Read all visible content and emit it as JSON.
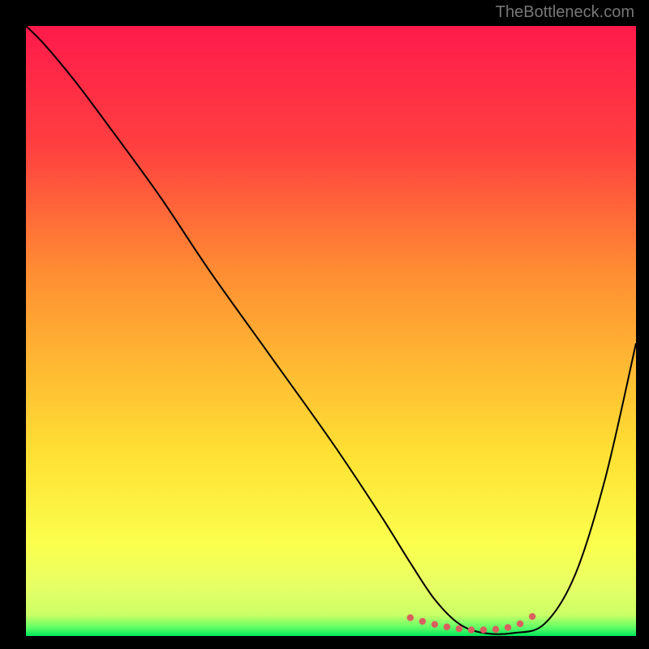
{
  "watermark": "TheBottleneck.com",
  "chart_data": {
    "type": "line",
    "title": "",
    "xlabel": "",
    "ylabel": "",
    "xlim": [
      0,
      100
    ],
    "ylim": [
      0,
      100
    ],
    "grid": false,
    "legend": false,
    "background_gradient": {
      "stops": [
        {
          "offset": 0.0,
          "color": "#ff1a4b"
        },
        {
          "offset": 0.2,
          "color": "#ff4040"
        },
        {
          "offset": 0.4,
          "color": "#ff8c33"
        },
        {
          "offset": 0.55,
          "color": "#ffb733"
        },
        {
          "offset": 0.7,
          "color": "#ffe033"
        },
        {
          "offset": 0.85,
          "color": "#fbff4d"
        },
        {
          "offset": 0.92,
          "color": "#e6ff66"
        },
        {
          "offset": 0.965,
          "color": "#ccff66"
        },
        {
          "offset": 0.985,
          "color": "#66ff66"
        },
        {
          "offset": 1.0,
          "color": "#00e65c"
        }
      ]
    },
    "series": [
      {
        "name": "bottleneck-curve",
        "color": "#000000",
        "stroke_width": 2,
        "x": [
          0,
          3,
          8,
          14,
          22,
          30,
          40,
          50,
          58,
          63,
          67,
          71,
          75,
          80,
          85,
          90,
          95,
          100
        ],
        "y": [
          100,
          97,
          91,
          83,
          72,
          60,
          46,
          32,
          20,
          12,
          6,
          2,
          0.5,
          0.5,
          2,
          10,
          26,
          48
        ]
      }
    ],
    "annotations": [
      {
        "name": "optimal-range-marker",
        "type": "dotted-segment",
        "color": "#d95f5f",
        "dot_radius": 4.2,
        "x": [
          63,
          65,
          67,
          69,
          71,
          73,
          75,
          77,
          79,
          81,
          83
        ],
        "y": [
          3.0,
          2.4,
          1.9,
          1.5,
          1.2,
          1.0,
          1.0,
          1.1,
          1.4,
          2.0,
          3.2
        ]
      }
    ]
  }
}
